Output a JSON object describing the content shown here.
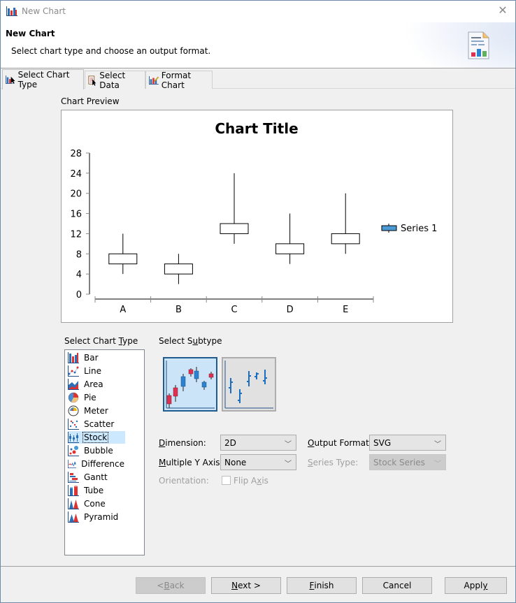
{
  "window": {
    "title": "New Chart",
    "close_icon": "close-icon"
  },
  "header": {
    "title": "New Chart",
    "subtitle": "Select chart type and choose an output format.",
    "icon": "chart-document-icon"
  },
  "tabs": [
    {
      "label": "Select Chart Type",
      "icon": "chart-type-icon",
      "active": true
    },
    {
      "label": "Select Data",
      "icon": "select-data-icon",
      "active": false
    },
    {
      "label": "Format Chart",
      "icon": "format-chart-icon",
      "active": false
    }
  ],
  "preview": {
    "label": "Chart Preview"
  },
  "chart_data": {
    "type": "stock",
    "title": "Chart Title",
    "categories": [
      "A",
      "B",
      "C",
      "D",
      "E"
    ],
    "series": [
      {
        "name": "Series 1",
        "low": [
          4,
          2,
          10,
          6,
          8
        ],
        "high": [
          12,
          8,
          24,
          16,
          20
        ],
        "open": [
          6,
          4,
          12,
          8,
          10
        ],
        "close": [
          8,
          6,
          14,
          10,
          12
        ]
      }
    ],
    "y_ticks": [
      0,
      4,
      8,
      12,
      16,
      20,
      24,
      28
    ],
    "ylim": [
      0,
      28
    ],
    "xlabel": "",
    "ylabel": "",
    "legend": "right",
    "legend_color": "#4a9ad4",
    "grid": false
  },
  "chart_type": {
    "label": "Select Chart Type",
    "label_mnemonic": "T",
    "items": [
      {
        "label": "Bar",
        "icon": "bar-chart-icon"
      },
      {
        "label": "Line",
        "icon": "line-chart-icon"
      },
      {
        "label": "Area",
        "icon": "area-chart-icon"
      },
      {
        "label": "Pie",
        "icon": "pie-chart-icon"
      },
      {
        "label": "Meter",
        "icon": "meter-chart-icon"
      },
      {
        "label": "Scatter",
        "icon": "scatter-chart-icon"
      },
      {
        "label": "Stock",
        "icon": "stock-chart-icon",
        "selected": true
      },
      {
        "label": "Bubble",
        "icon": "bubble-chart-icon"
      },
      {
        "label": "Difference",
        "icon": "difference-chart-icon"
      },
      {
        "label": "Gantt",
        "icon": "gantt-chart-icon"
      },
      {
        "label": "Tube",
        "icon": "tube-chart-icon"
      },
      {
        "label": "Cone",
        "icon": "cone-chart-icon"
      },
      {
        "label": "Pyramid",
        "icon": "pyramid-chart-icon"
      }
    ]
  },
  "subtype": {
    "label": "Select Subtype",
    "items": [
      {
        "name": "candlestick-subtype",
        "selected": true
      },
      {
        "name": "bar-stick-subtype",
        "selected": false
      }
    ]
  },
  "options": {
    "dimension": {
      "label": "Dimension:",
      "value": "2D"
    },
    "multiple_y_axis": {
      "label": "Multiple Y Axis:",
      "value": "None"
    },
    "orientation": {
      "label": "Orientation:",
      "checkbox_label": "Flip Axis",
      "checked": false,
      "disabled": true
    },
    "output_format": {
      "label": "Output Format:",
      "value": "SVG"
    },
    "series_type": {
      "label": "Series Type:",
      "value": "Stock Series",
      "disabled": true
    }
  },
  "buttons": {
    "back": "< Back",
    "next": "Next >",
    "finish": "Finish",
    "cancel": "Cancel",
    "apply": "Apply"
  }
}
